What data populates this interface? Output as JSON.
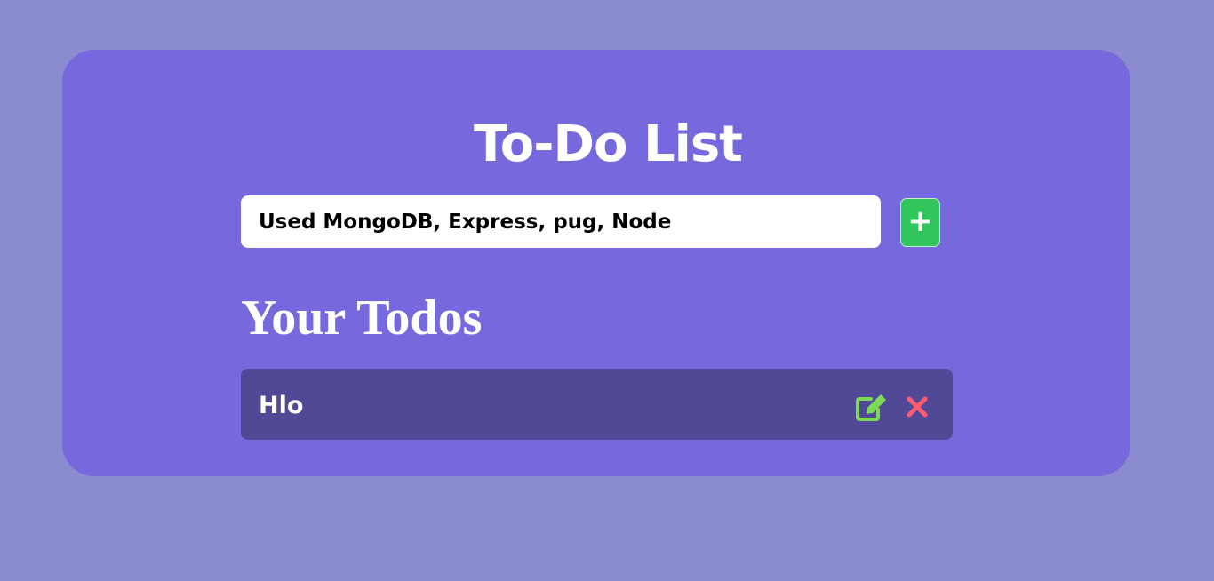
{
  "app": {
    "title": "To-Do List"
  },
  "add_form": {
    "input_value": "Used MongoDB, Express, pug, Node",
    "add_button_label": "+"
  },
  "todos_section": {
    "heading": "Your Todos",
    "items": [
      {
        "text": "Hlo",
        "edit_icon": "edit-icon",
        "delete_icon": "close-icon"
      }
    ]
  },
  "colors": {
    "page_background": "#8b8bd0",
    "card_background": "#7669de",
    "todo_item_background": "#514896",
    "add_button": "#33c55d",
    "edit_icon": "#7ed957",
    "delete_icon": "#ff5c70",
    "text": "#ffffff"
  }
}
